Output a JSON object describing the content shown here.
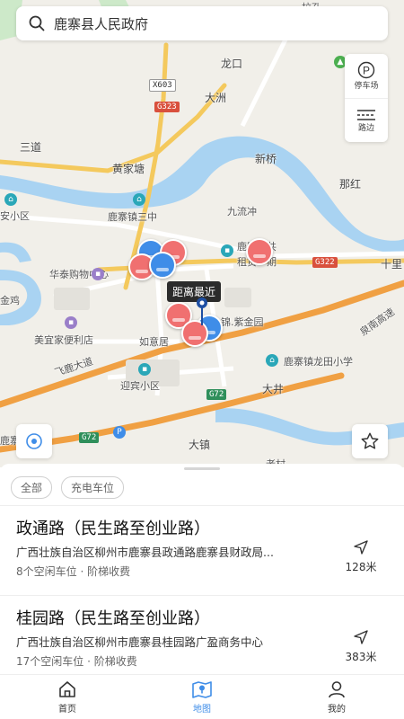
{
  "search": {
    "value": "鹿寨县人民政府"
  },
  "map": {
    "labels": {
      "longkou": "龙口",
      "dazhou": "大洲",
      "sandao": "三道",
      "huangjiatang": "黄家塘",
      "xinqiao": "新桥",
      "nahong": "那红",
      "anxiaoqu": "安小区",
      "zhensanzhong": "鹿寨镇三中",
      "jiuliuchong": "九流冲",
      "huataigouwu": "华泰购物中心",
      "luzhai_gonggong": "鹿寨公共",
      "zuyu_yiqi": "租赁一期",
      "shili": "十里",
      "meiyijia": "美宜家便利店",
      "ruyiju": "如意居",
      "jinziyuan": "锦.紫金园",
      "feilu": "飞鹿大道",
      "quannan": "泉南高速",
      "longtian": "鹿寨镇龙田小学",
      "yingbin": "迎宾小区",
      "dajing": "大井",
      "dazhen": "大镇",
      "jiji": "金鸡",
      "luzhai_yuan": "鹿寨园",
      "lao": "老村",
      "xia": "下",
      "pinyin_top": "拉孔"
    },
    "road_badges": {
      "x603": "X603",
      "g323": "G323",
      "g322": "G322",
      "g72a": "G72",
      "g72b": "G72"
    },
    "distance_tag": "距离最近",
    "side_panel": {
      "parking_label": "停车场",
      "roadside_label": "路边"
    },
    "colors": {
      "marker_red": "#f07070",
      "marker_blue": "#3f8de8",
      "accent": "#3f8de8"
    }
  },
  "filters": [
    {
      "label": "全部"
    },
    {
      "label": "充电车位"
    }
  ],
  "parking_list": [
    {
      "title": "政通路（民生路至创业路）",
      "address": "广西壮族自治区柳州市鹿寨县政通路鹿寨县财政局...",
      "meta": "8个空闲车位 · 阶梯收费",
      "distance": "128米"
    },
    {
      "title": "桂园路（民生路至创业路）",
      "address": "广西壮族自治区柳州市鹿寨县桂园路广盈商务中心",
      "meta": "17个空闲车位 · 阶梯收费",
      "distance": "383米"
    }
  ],
  "tabs": [
    {
      "label": "首页",
      "icon": "home-icon"
    },
    {
      "label": "地图",
      "icon": "map-icon",
      "active": true
    },
    {
      "label": "我的",
      "icon": "user-icon"
    }
  ]
}
